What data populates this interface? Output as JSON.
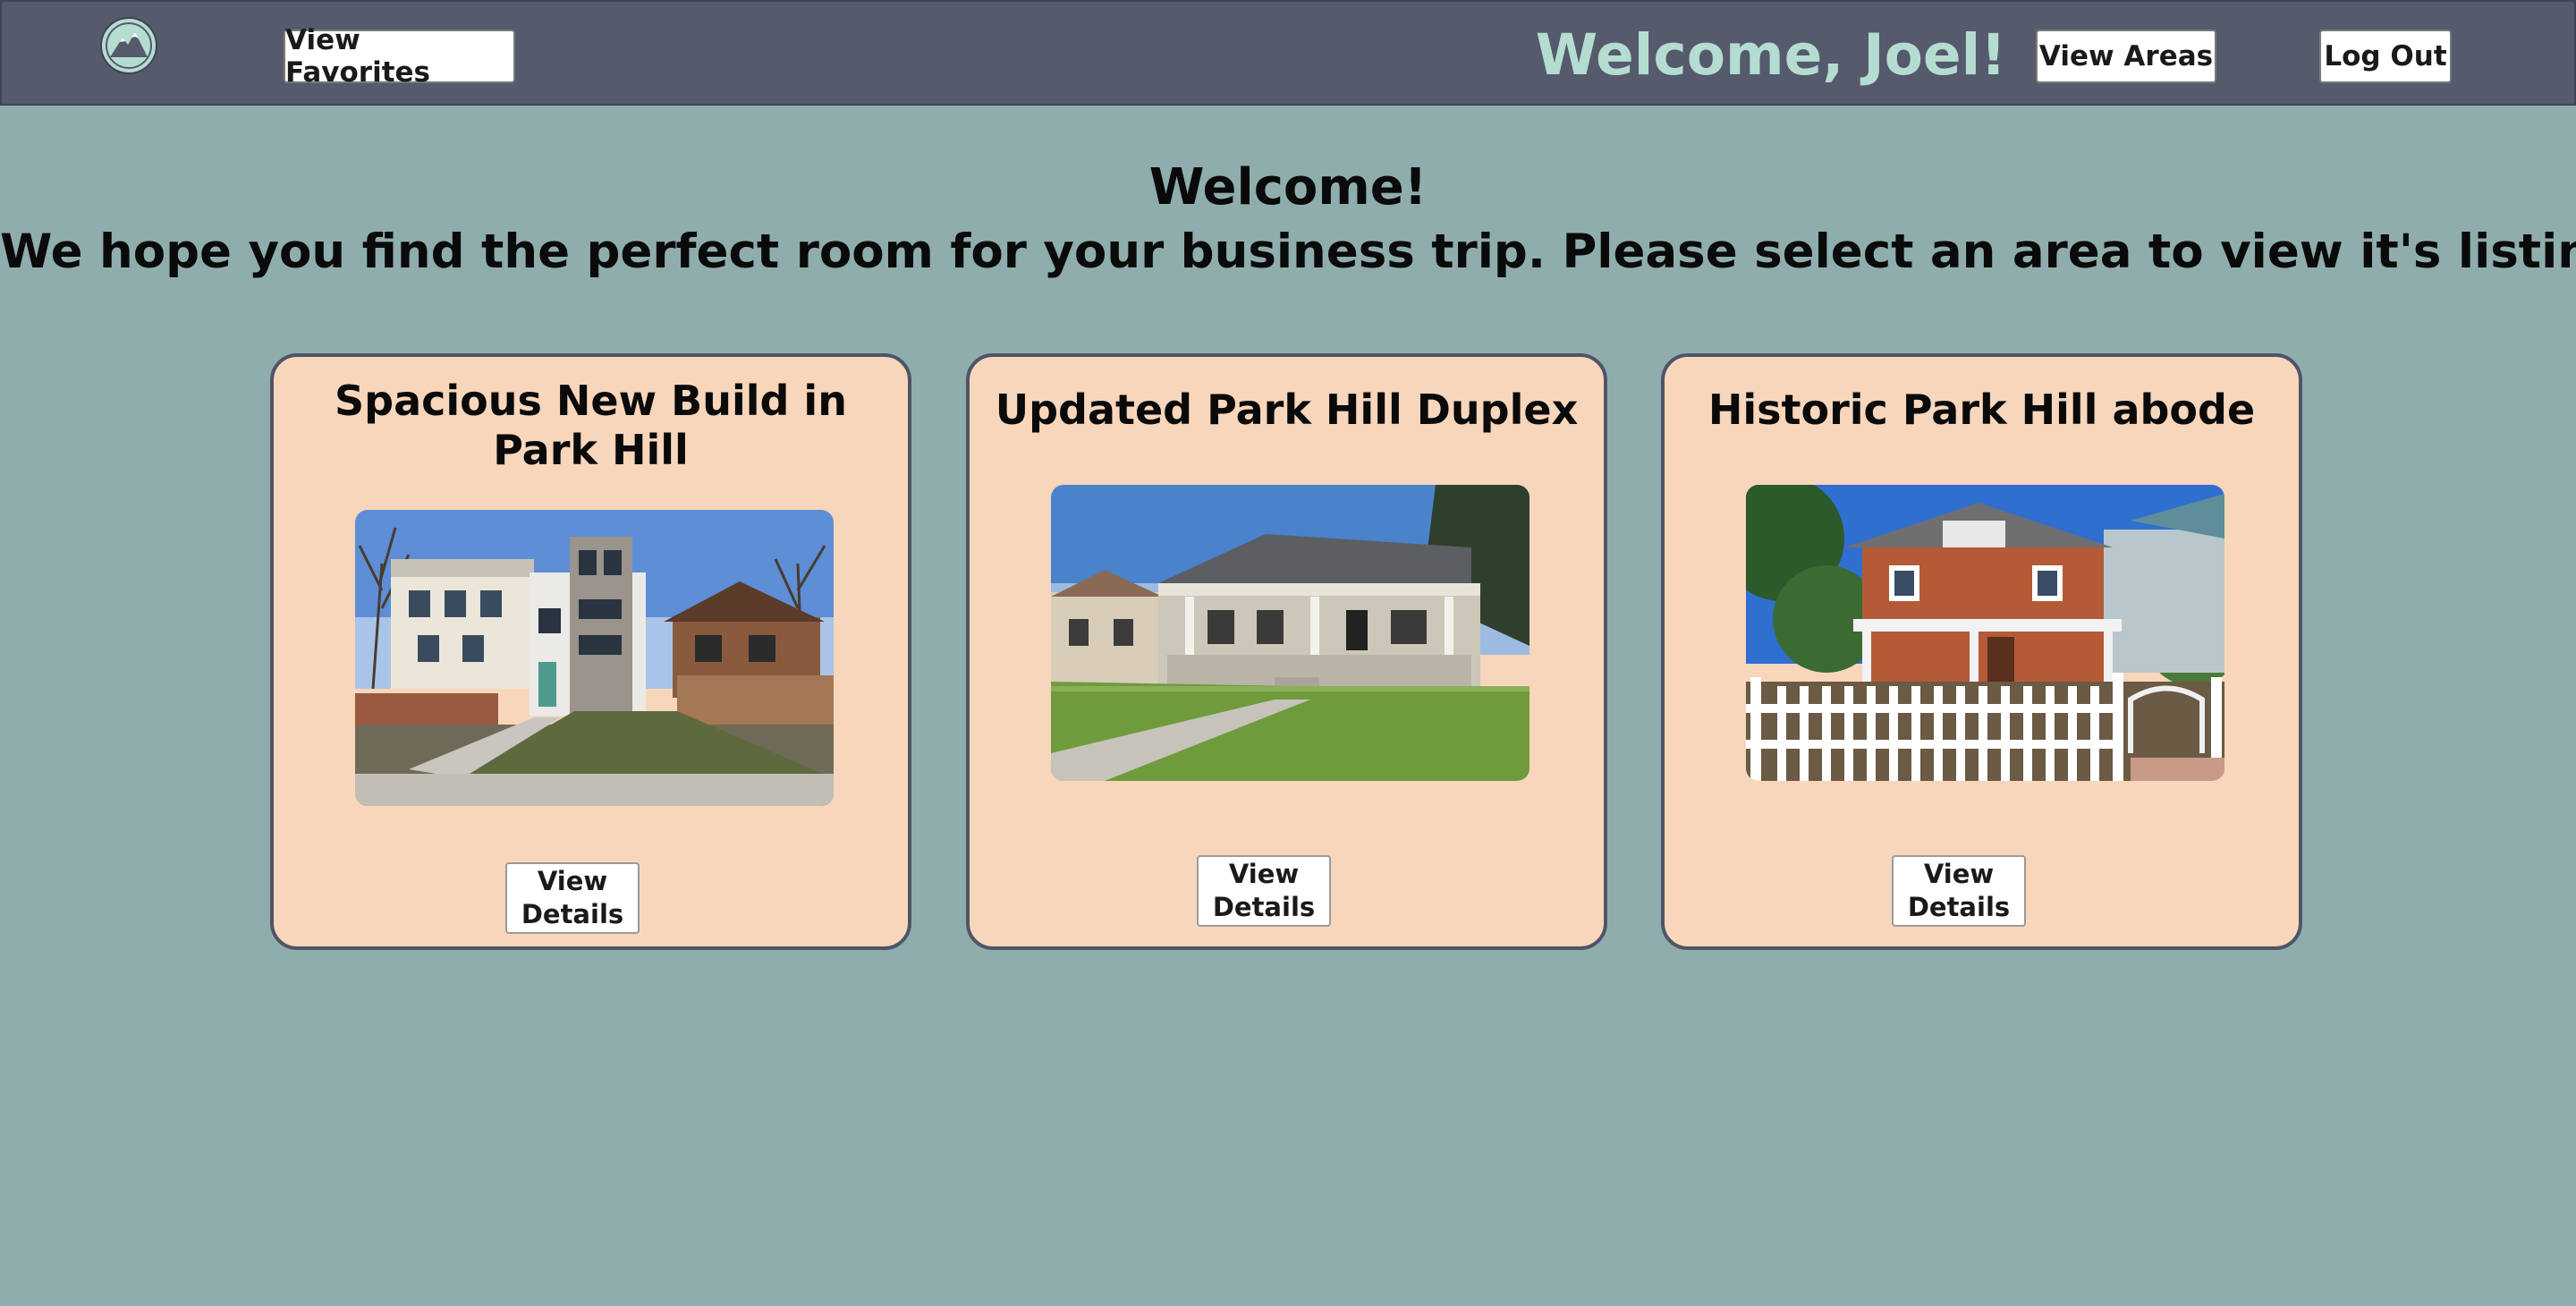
{
  "header": {
    "logo_icon": "mountain-logo-icon",
    "favorites_label": "View Favorites",
    "welcome_text": "Welcome, Joel!",
    "areas_label": "View Areas",
    "logout_label": "Log Out"
  },
  "intro": {
    "heading": "Welcome!",
    "subheading": "We hope you find the perfect room for your business trip. Please select an area to view it's listings."
  },
  "listings": [
    {
      "title": "Spacious New Build in Park Hill",
      "button_label": "View Details"
    },
    {
      "title": "Updated Park Hill Duplex",
      "button_label": "View Details"
    },
    {
      "title": "Historic Park Hill abode",
      "button_label": "View Details"
    }
  ],
  "colors": {
    "header_bg": "#555a6c",
    "page_bg": "#90adae",
    "card_bg": "#f8d6bc",
    "welcome_accent": "#b5dcd0"
  }
}
